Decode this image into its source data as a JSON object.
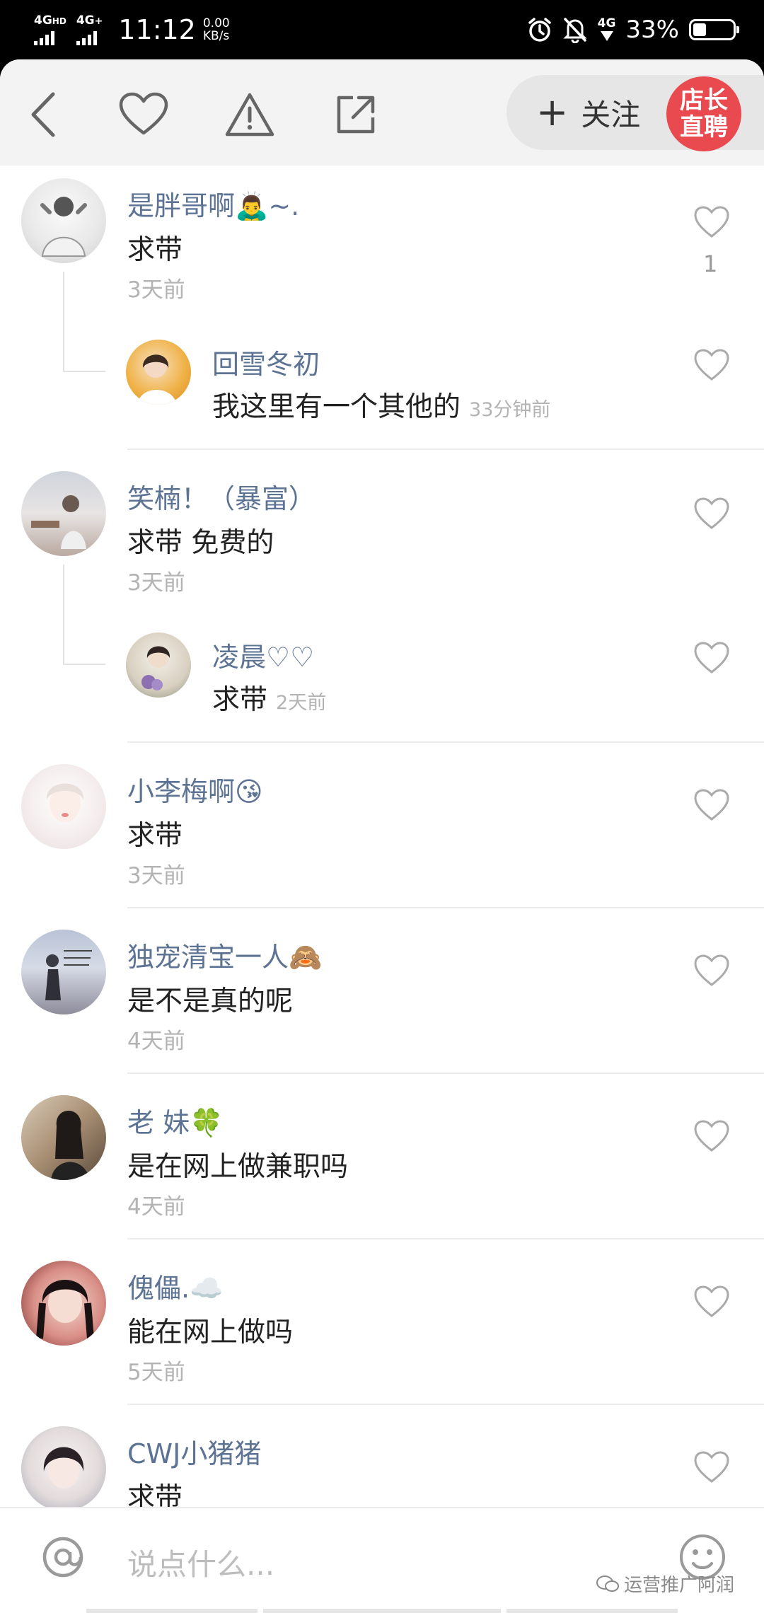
{
  "status_bar": {
    "sim1": "4G",
    "sim1_sup": "HD",
    "sim2": "4G",
    "sim2_sup": "+",
    "time": "11:12",
    "speed_value": "0.00",
    "speed_unit": "KB/s",
    "sim3": "4G",
    "battery_pct": "33%",
    "battery_level": 0.33
  },
  "toolbar": {
    "follow_plus": "+",
    "follow_label": "关注",
    "badge_line1": "店长",
    "badge_line2": "直聘"
  },
  "comments": [
    {
      "name": "是胖哥啊🙇‍♂️~.",
      "text": "求带",
      "time": "3天前",
      "likes": "1",
      "reply": {
        "name": "回雪冬初",
        "text": "我这里有一个其他的",
        "time": "33分钟前"
      }
    },
    {
      "name": "笑楠！（暴富）",
      "text": "求带  免费的",
      "time": "3天前",
      "reply": {
        "name": "凌晨♡♡",
        "text": "求带",
        "time": "2天前"
      }
    },
    {
      "name": "小李梅啊😘",
      "text": "求带",
      "time": "3天前"
    },
    {
      "name": "独宠清宝一人🙈",
      "text": "是不是真的呢",
      "time": "4天前"
    },
    {
      "name": "老 妹🍀",
      "text": "是在网上做兼职吗",
      "time": "4天前"
    },
    {
      "name": "傀儡.☁️",
      "text": "能在网上做吗",
      "time": "5天前"
    },
    {
      "name": "CWJ小猪猪",
      "text": "求带"
    }
  ],
  "input": {
    "placeholder": "说点什么...",
    "at_symbol": "@"
  },
  "watermark": "运营推广阿润"
}
